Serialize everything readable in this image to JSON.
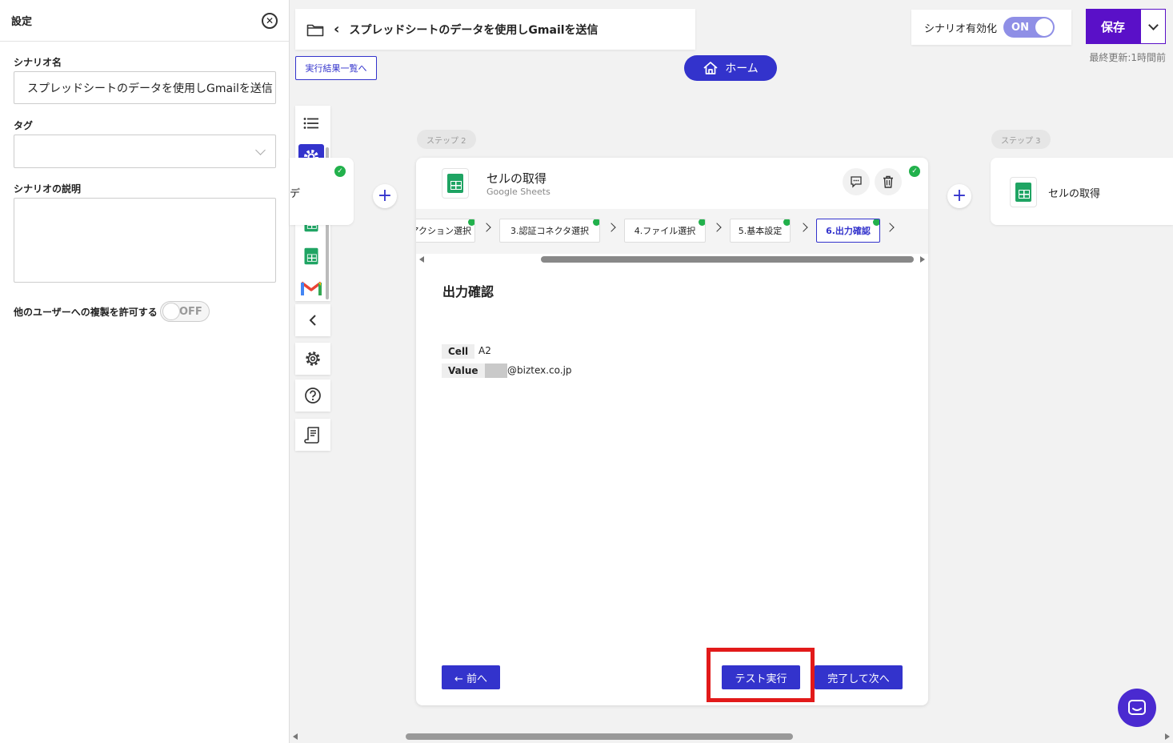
{
  "settings": {
    "title": "設定",
    "close_icon": "close-circle-icon",
    "name_label": "シナリオ名",
    "name_value": "スプレッドシートのデータを使用しGmailを送信",
    "tag_label": "タグ",
    "tag_value": "",
    "desc_label": "シナリオの説明",
    "desc_value": "",
    "copy_label": "他のユーザーへの複製を許可する",
    "copy_toggle": "OFF"
  },
  "header": {
    "back_chevron": "‹",
    "scenario_title": "スプレッドシートのデータを使用しGmailを送信",
    "results_link": "実行結果一覧へ",
    "home_label": "ホーム",
    "enable_label": "シナリオ有効化",
    "enable_toggle": "ON",
    "save_label": "保存",
    "updated": "最終更新:1時間前"
  },
  "steps": {
    "step2_label": "ステップ 2",
    "step3_label": "ステップ 3",
    "prev_card_char": "デ"
  },
  "card": {
    "title": "セルの取得",
    "subtitle": "Google Sheets",
    "tabs": [
      {
        "label": "アクション選択"
      },
      {
        "label": "3.認証コネクタ選択"
      },
      {
        "label": "4.ファイル選択"
      },
      {
        "label": "5.基本設定"
      },
      {
        "label": "6.出力確認"
      }
    ],
    "section_title": "出力確認",
    "rows": [
      {
        "key": "Cell",
        "value": "A2"
      },
      {
        "key": "Value",
        "value": "@biztex.co.jp"
      }
    ],
    "prev_btn": "← 前へ",
    "test_btn": "テスト実行",
    "next_btn": "完了して次へ"
  },
  "next_card": {
    "title": "セルの取得"
  },
  "colors": {
    "primary": "#3333cc",
    "save": "#5a10c8",
    "highlight": "#e21a1a",
    "success": "#22b14c"
  }
}
